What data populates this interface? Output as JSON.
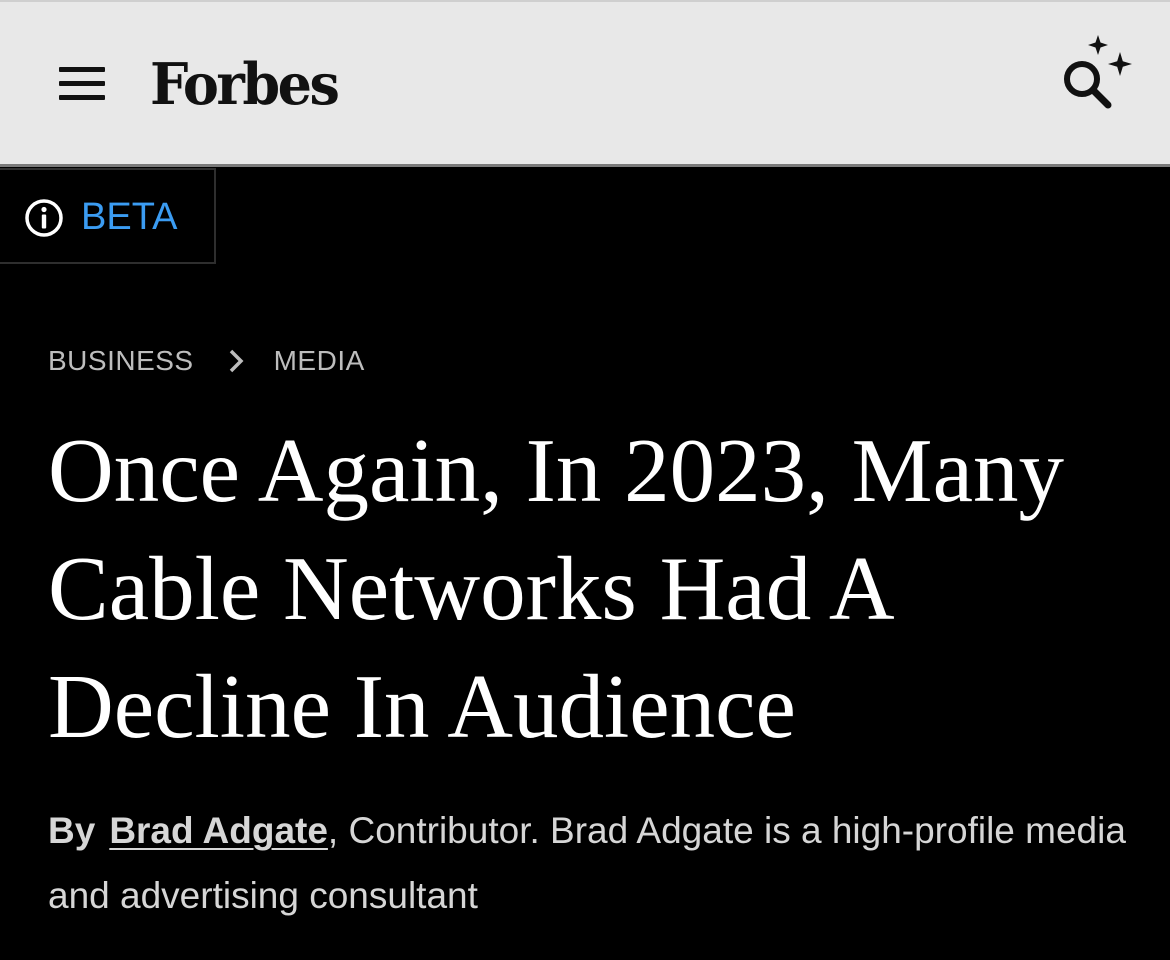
{
  "header": {
    "menu_icon": "hamburger-menu-icon",
    "logo_text": "Forbes",
    "search_icon": "ai-search-sparkle-icon"
  },
  "beta": {
    "icon": "info-circle-icon",
    "label": "BETA",
    "color": "#3b9cf2"
  },
  "breadcrumb": {
    "items": [
      "BUSINESS",
      "MEDIA"
    ],
    "separator_icon": "chevron-right-icon"
  },
  "article": {
    "headline_lines": [
      "Once Again, In 2023, Many",
      "Cable Networks Had A",
      "Decline In Audience"
    ],
    "byline": {
      "prefix": "By",
      "author": "Brad Adgate",
      "description": ", Contributor. Brad Adgate is a high-profile media and advertising consultant"
    }
  },
  "colors": {
    "topbar_bg": "#e8e8e8",
    "page_bg": "#000000",
    "headline": "#ffffff",
    "meta_text": "#bdbdbd"
  }
}
